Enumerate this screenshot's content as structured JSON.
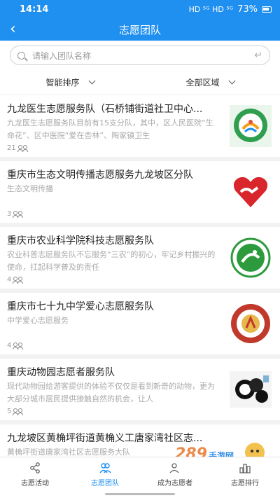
{
  "status": {
    "time": "14:14",
    "battery": "73%",
    "net": "HD ⁵ᴳ HD ⁵ᴳ"
  },
  "nav": {
    "title": "志愿团队"
  },
  "search": {
    "placeholder": "请输入团队名称"
  },
  "filters": {
    "sort": "智能排序",
    "area": "全部区域"
  },
  "teams": [
    {
      "name": "九龙医生志愿服务队（石桥铺街道社卫中心...",
      "desc": "九龙医生志愿服务队目前有15支分队，其中，区人民医院“生命花”、区中医院“爱在杏林”、陶家镇卫生",
      "count": "21"
    },
    {
      "name": "重庆市生态文明传播志愿服务九龙坡区分队",
      "desc": "生态文明传播",
      "count": "3"
    },
    {
      "name": "重庆市农业科学院科技志愿服务队",
      "desc": "农业科普志愿服务队不忘服务“三农”的初心，牢记乡村振兴的使命，扛起科学普及的责任",
      "count": "4"
    },
    {
      "name": "重庆市七十九中学爱心志愿服务队",
      "desc": "中学爱心志愿服务",
      "count": "4"
    },
    {
      "name": "重庆动物园志愿者服务队",
      "desc": "现代动物园给游客提供的体验不仅仅是看到新奇的动物，更为大部分城市居民提供接触自然的机会，让人",
      "count": "5"
    },
    {
      "name": "九龙坡区黄桷坪街道黄桷义工唐家湾社区志...",
      "desc": "黄桷坪街道唐家湾社区志愿服务大队",
      "count": ""
    }
  ],
  "tabs": [
    "志愿活动",
    "志愿团队",
    "成为志愿者",
    "志愿排行"
  ],
  "watermark": {
    "main": "289",
    "sub": "手游网"
  },
  "colors": {
    "primary": "#1f8ff0"
  }
}
